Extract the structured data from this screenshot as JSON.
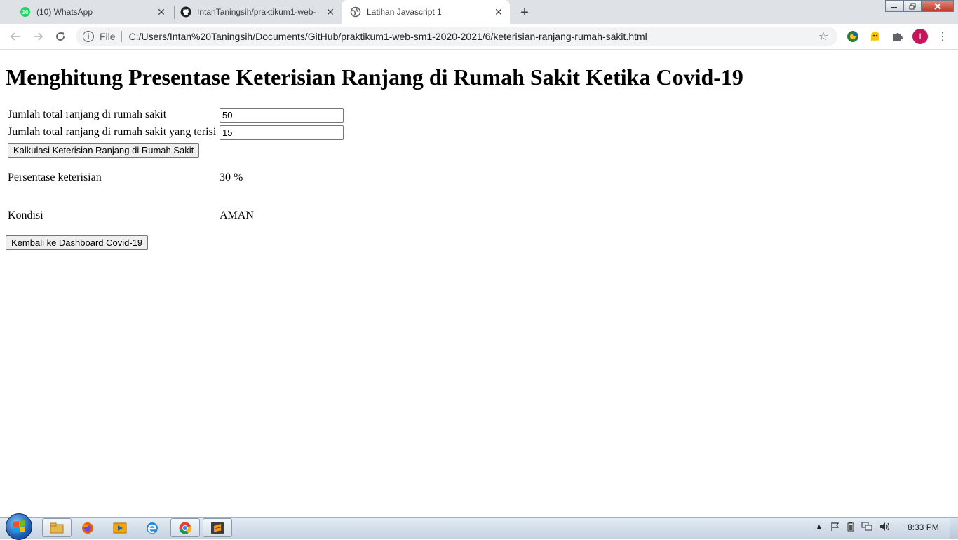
{
  "browser": {
    "tabs": [
      {
        "title": "(10) WhatsApp",
        "badge": "10",
        "icon": "whatsapp-icon"
      },
      {
        "title": "IntanTaningsih/praktikum1-web-",
        "icon": "github-icon"
      },
      {
        "title": "Latihan Javascript 1",
        "icon": "globe-icon",
        "active": true
      }
    ],
    "new_tab_label": "+",
    "omnibox": {
      "scheme_label": "File",
      "url": "C:/Users/Intan%20Taningsih/Documents/GitHub/praktikum1-web-sm1-2020-2021/6/keterisian-ranjang-rumah-sakit.html"
    },
    "profile_initial": "I"
  },
  "page": {
    "heading": "Menghitung Presentase Keterisian Ranjang di Rumah Sakit Ketika Covid-19",
    "total_beds_label": "Jumlah total ranjang di rumah sakit",
    "total_beds_value": "50",
    "occupied_beds_label": "Jumlah total ranjang di rumah sakit yang terisi",
    "occupied_beds_value": "15",
    "calculate_button": "Kalkulasi Keterisian Ranjang di Rumah Sakit",
    "occupancy_label": "Persentase keterisian",
    "occupancy_value": "30 %",
    "condition_label": "Kondisi",
    "condition_value": "AMAN",
    "back_button": "Kembali ke Dashboard Covid-19"
  },
  "taskbar": {
    "apps": [
      "file-explorer-icon",
      "firefox-icon",
      "media-player-icon",
      "edge-icon",
      "chrome-icon",
      "sublime-text-icon"
    ],
    "clock": "8:33 PM"
  },
  "colors": {
    "tabstrip": "#dee1e6",
    "accent_avatar": "#c2185b",
    "whatsapp_green": "#25d366"
  }
}
